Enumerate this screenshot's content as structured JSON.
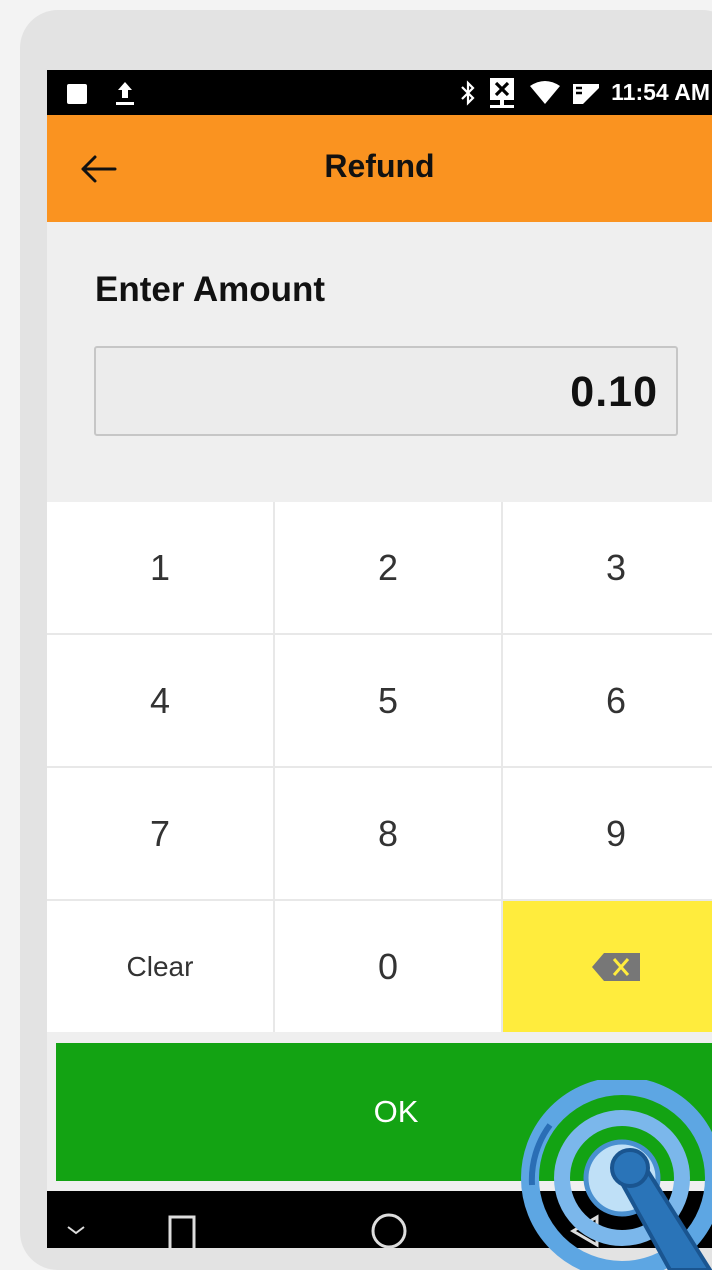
{
  "status_bar": {
    "time": "11:54 AM",
    "icons": [
      "notification-square-icon",
      "upload-icon",
      "bluetooth-icon",
      "network-blocked-icon",
      "wifi-icon",
      "mail-icon"
    ]
  },
  "app_bar": {
    "title": "Refund",
    "back_icon": "arrow-left-icon"
  },
  "amount": {
    "label": "Enter Amount",
    "value": "0.10"
  },
  "keypad": {
    "keys": [
      "1",
      "2",
      "3",
      "4",
      "5",
      "6",
      "7",
      "8",
      "9",
      "Clear",
      "0"
    ],
    "backspace_icon": "backspace-icon"
  },
  "ok_button": {
    "label": "OK"
  },
  "nav_bar": {
    "icons": [
      "keyboard-hide-icon",
      "recents-icon",
      "home-icon",
      "back-icon"
    ]
  },
  "colors": {
    "app_bar": "#fa9320",
    "ok_button": "#13a313",
    "backspace_key": "#ffec3d",
    "status_bar": "#000000"
  }
}
